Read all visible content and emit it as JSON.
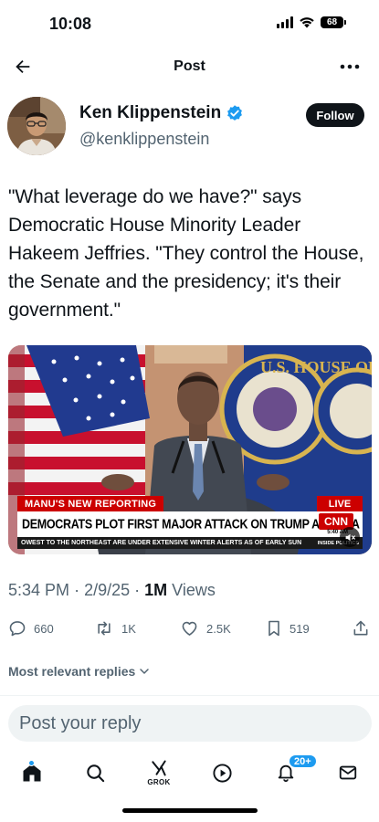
{
  "status_bar": {
    "time": "10:08",
    "battery": "68"
  },
  "header": {
    "title": "Post",
    "back_icon": "arrow-left-icon",
    "more_icon": "more-horizontal-icon"
  },
  "author": {
    "name": "Ken Klippenstein",
    "handle": "@kenklippenstein",
    "verified": true,
    "follow_label": "Follow"
  },
  "post": {
    "text": "\"What leverage do we have?\" says Democratic House Minority Leader Hakeem Jeffries. \"They control the House, the Senate and the presidency; it's their government.\"",
    "media": {
      "tag": "MANU'S NEW REPORTING",
      "live": "LIVE",
      "headline": "DEMOCRATS PLOT FIRST MAJOR ATTACK ON TRUMP AGENDA",
      "network": "CNN",
      "clock": "5:40 AM",
      "ticker": "OWEST TO THE NORTHEAST ARE UNDER EXTENSIVE WINTER ALERTS AS OF EARLY SUN",
      "ticker_source": "INSIDE POLITICS"
    },
    "time": "5:34 PM",
    "date": "2/9/25",
    "views": "1M",
    "views_label": "Views"
  },
  "actions": {
    "replies": "660",
    "reposts": "1K",
    "likes": "2.5K",
    "bookmarks": "519"
  },
  "replies_sort": "Most relevant replies",
  "reply_placeholder": "Post your reply",
  "bottom_nav": {
    "grok_label": "GROK",
    "notifications_badge": "20+"
  },
  "colors": {
    "accent": "#1d9bf0",
    "text": "#0f1419",
    "muted": "#536471",
    "live_red": "#cc0000"
  }
}
